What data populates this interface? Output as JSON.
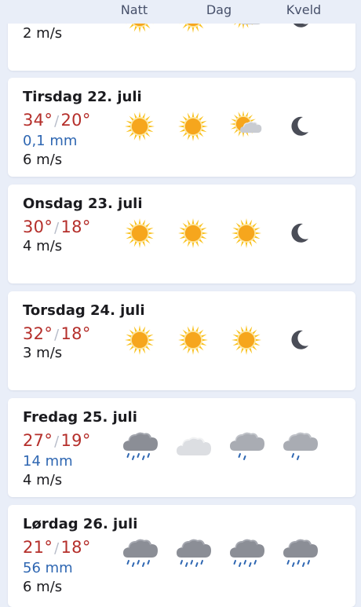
{
  "columns": {
    "night": "Natt",
    "day": "Dag",
    "evening": "Kveld"
  },
  "top_partial": {
    "wind": "2 m/s",
    "icons": [
      "sun-icon",
      "sun-icon",
      "partly-cloudy-icon",
      "moon-icon"
    ]
  },
  "days": [
    {
      "title": "Tirsdag 22. juli",
      "high": "34°",
      "low": "20°",
      "precip": "0,1 mm",
      "wind": "6 m/s",
      "icons": [
        "sun-icon",
        "sun-icon",
        "partly-cloudy-icon",
        "moon-icon"
      ]
    },
    {
      "title": "Onsdag 23. juli",
      "high": "30°",
      "low": "18°",
      "precip": "",
      "wind": "4 m/s",
      "icons": [
        "sun-icon",
        "sun-icon",
        "sun-icon",
        "moon-icon"
      ]
    },
    {
      "title": "Torsdag 24. juli",
      "high": "32°",
      "low": "18°",
      "precip": "",
      "wind": "3 m/s",
      "icons": [
        "sun-icon",
        "sun-icon",
        "sun-icon",
        "moon-icon"
      ]
    },
    {
      "title": "Fredag 25. juli",
      "high": "27°",
      "low": "19°",
      "precip": "14 mm",
      "wind": "4 m/s",
      "icons": [
        "rain-icon",
        "cloud-icon",
        "light-rain-icon",
        "light-rain-icon"
      ]
    },
    {
      "title": "Lørdag 26. juli",
      "high": "21°",
      "low": "18°",
      "precip": "56 mm",
      "wind": "6 m/s",
      "icons": [
        "rain-icon",
        "rain-icon",
        "rain-icon",
        "rain-icon"
      ]
    }
  ],
  "colors": {
    "temperature": "#b52f2b",
    "precipitation": "#2f67b2",
    "sun": "#f6a61d",
    "moon": "#4a4d57",
    "cloud": "#8b8e96"
  }
}
